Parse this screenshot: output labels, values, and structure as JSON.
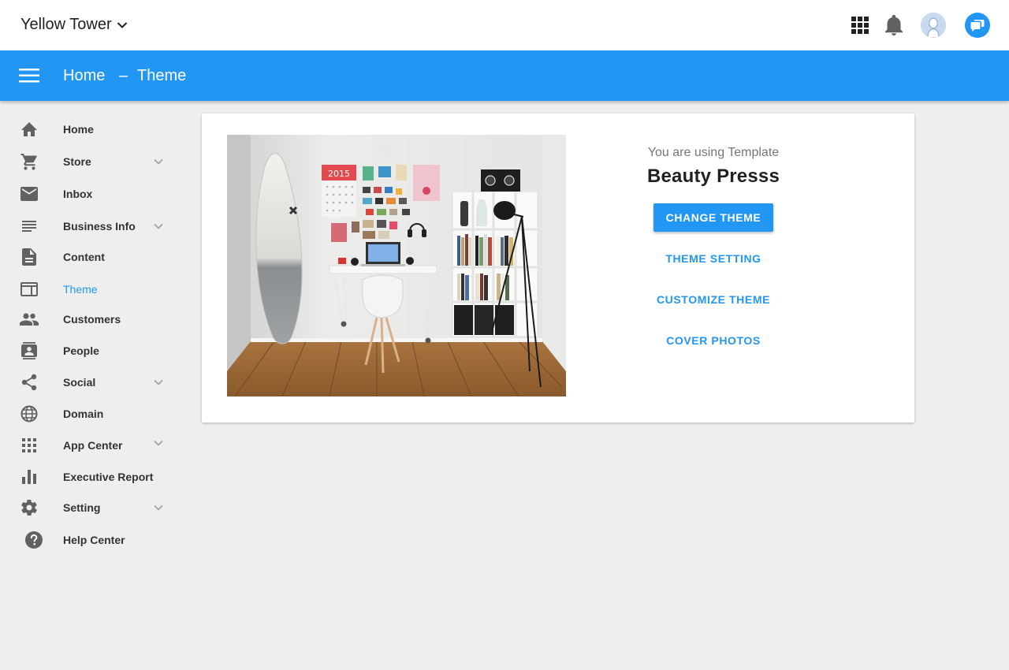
{
  "topbar": {
    "site_name": "Yellow Tower",
    "icons": [
      "apps-grid-icon",
      "notifications-bell-icon",
      "user-avatar",
      "chat-icon"
    ]
  },
  "appbar": {
    "breadcrumb_home": "Home",
    "breadcrumb_separator": "–",
    "breadcrumb_current": "Theme"
  },
  "sidebar": {
    "items": [
      {
        "label": "Home",
        "icon": "home-icon",
        "expandable": false
      },
      {
        "label": "Store",
        "icon": "cart-icon",
        "expandable": true
      },
      {
        "label": "Inbox",
        "icon": "mail-icon",
        "expandable": false
      },
      {
        "label": "Business Info",
        "icon": "lines-icon",
        "expandable": true
      },
      {
        "label": "Content",
        "icon": "document-icon",
        "expandable": false
      },
      {
        "label": "Theme",
        "icon": "web-layout-icon",
        "expandable": false,
        "active": true
      },
      {
        "label": "Customers",
        "icon": "people-icon",
        "expandable": false
      },
      {
        "label": "People",
        "icon": "contacts-icon",
        "expandable": false
      },
      {
        "label": "Social",
        "icon": "share-icon",
        "expandable": true
      },
      {
        "label": "Domain",
        "icon": "globe-icon",
        "expandable": false
      },
      {
        "label": "App Center",
        "icon": "apps-icon",
        "expandable": true
      },
      {
        "label": "Executive Report",
        "icon": "bar-chart-icon",
        "expandable": false
      },
      {
        "label": "Setting",
        "icon": "gear-icon",
        "expandable": true
      },
      {
        "label": "Help Center",
        "icon": "help-icon",
        "expandable": false
      }
    ]
  },
  "theme_card": {
    "using_text": "You are using Template",
    "template_name": "Beauty Presss",
    "primary_button": "CHANGE THEME",
    "actions": [
      "THEME SETTING",
      "CUSTOMIZE THEME",
      "COVER PHOTOS"
    ],
    "calendar_year": "2015"
  },
  "colors": {
    "accent": "#2196f3",
    "background": "#eeeeee",
    "icon_grey": "#616161"
  }
}
